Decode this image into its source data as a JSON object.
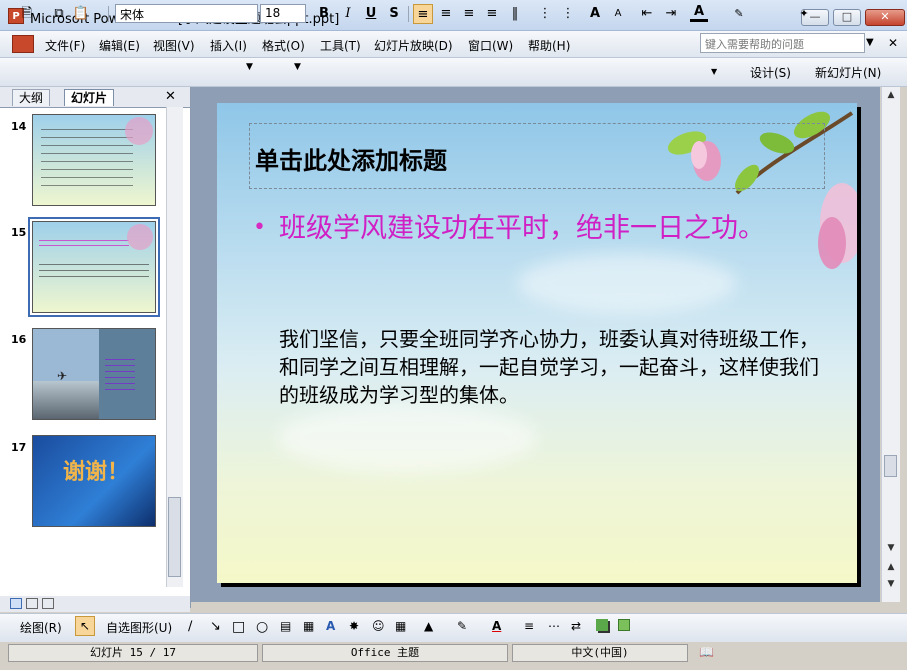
{
  "window": {
    "title": "Microsoft PowerPoint - [学风建设主题班会ppt.ppt]",
    "app_icon_letter": "P"
  },
  "menu": {
    "items": [
      "文件(F)",
      "编辑(E)",
      "视图(V)",
      "插入(I)",
      "格式(O)",
      "工具(T)",
      "幻灯片放映(D)",
      "窗口(W)",
      "帮助(H)"
    ],
    "help_placeholder": "键入需要帮助的问题"
  },
  "toolbar": {
    "font_name": "宋体",
    "font_size": "18",
    "bold": "B",
    "italic": "I",
    "underline": "U",
    "shadow": "S",
    "design_label": "设计(S)",
    "new_slide_label": "新幻灯片(N)"
  },
  "left_pane": {
    "tab_outline": "大纲",
    "tab_slides": "幻灯片",
    "selected_slide": 15,
    "slides": [
      {
        "number": "14"
      },
      {
        "number": "15"
      },
      {
        "number": "16"
      },
      {
        "number": "17",
        "text": "谢谢！"
      }
    ]
  },
  "slide": {
    "title_placeholder": "单击此处添加标题",
    "bullet": "班级学风建设功在平时，绝非一日之功。",
    "body": "我们坚信，只要全班同学齐心协力，班委认真对待班级工作，和同学之间互相理解，一起自觉学习，一起奋斗，这样使我们的班级成为学习型的集体。"
  },
  "drawing_toolbar": {
    "draw_label": "绘图(R)",
    "autoshapes_label": "自选图形(U)"
  },
  "status": {
    "slide_info": "幻灯片 15 / 17",
    "theme": "Office 主题",
    "language": "中文(中国)"
  },
  "colors": {
    "bullet_color": "#d01fc4",
    "selection_border": "#3d6bb4"
  }
}
